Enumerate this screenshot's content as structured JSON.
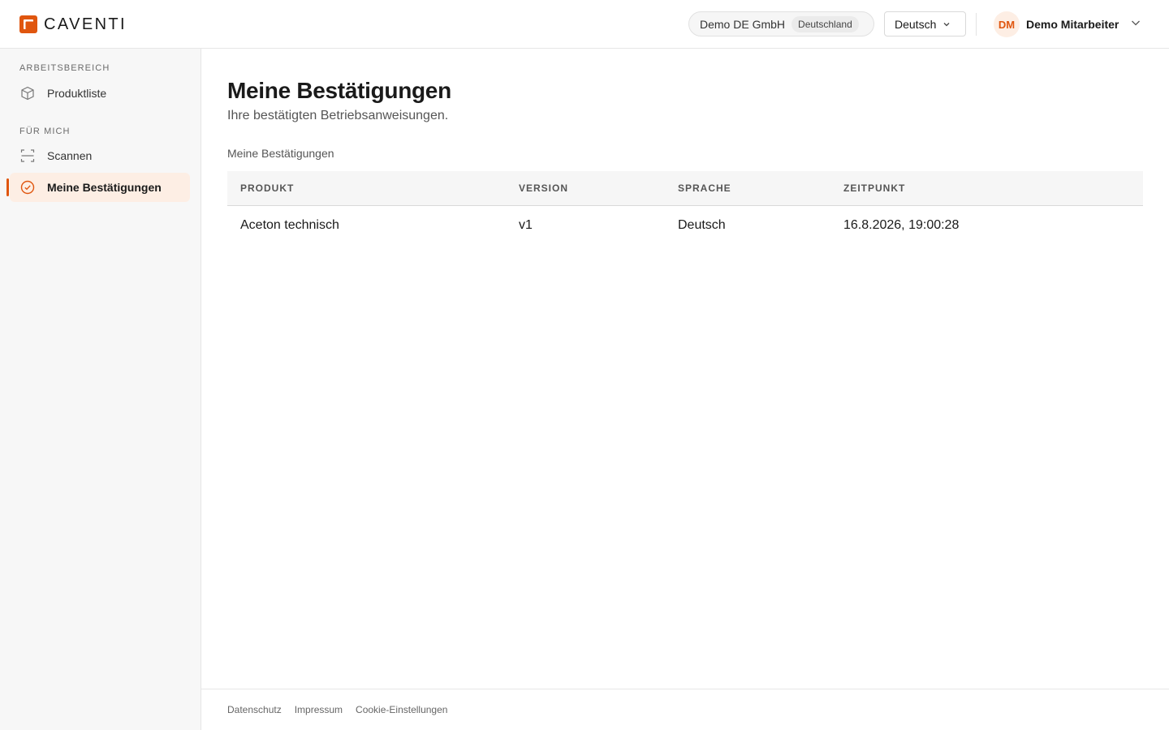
{
  "brand": {
    "name": "CAVENTI",
    "accent": "#e0560f"
  },
  "header": {
    "org_name": "Demo DE GmbH",
    "org_country": "Deutschland",
    "language": "Deutsch",
    "user_initials": "DM",
    "user_name": "Demo Mitarbeiter"
  },
  "sidebar": {
    "sections": [
      {
        "label": "ARBEITSBEREICH"
      },
      {
        "label": "FÜR MICH"
      }
    ],
    "items": [
      {
        "label": "Produktliste",
        "icon": "box-icon"
      },
      {
        "label": "Scannen",
        "icon": "scan-icon"
      },
      {
        "label": "Meine Bestätigungen",
        "icon": "check-circle-icon",
        "active": true
      }
    ]
  },
  "main": {
    "title": "Meine Bestätigungen",
    "subtitle": "Ihre bestätigten Betriebsanweisungen.",
    "table_caption": "Meine Bestätigungen",
    "table": {
      "headers": [
        "PRODUKT",
        "VERSION",
        "SPRACHE",
        "ZEITPUNKT"
      ],
      "rows": [
        [
          "Aceton technisch",
          "v1",
          "Deutsch",
          "16.8.2026, 19:00:28"
        ]
      ]
    }
  },
  "footer": {
    "links": [
      "Datenschutz",
      "Impressum",
      "Cookie-Einstellungen"
    ]
  }
}
